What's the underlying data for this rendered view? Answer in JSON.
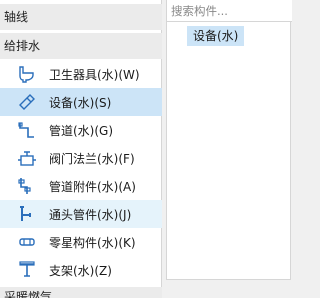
{
  "categories": {
    "axis": "轴线",
    "water": "给排水",
    "hvac": "采暖燃气"
  },
  "items": [
    {
      "label": "卫生器具(水)(W)",
      "icon": "sanitary-fixture-icon",
      "state": "normal"
    },
    {
      "label": "设备(水)(S)",
      "icon": "equipment-icon",
      "state": "selected"
    },
    {
      "label": "管道(水)(G)",
      "icon": "pipe-icon",
      "state": "normal"
    },
    {
      "label": "阀门法兰(水)(F)",
      "icon": "valve-flange-icon",
      "state": "normal"
    },
    {
      "label": "管道附件(水)(A)",
      "icon": "pipe-accessory-icon",
      "state": "normal"
    },
    {
      "label": "通头管件(水)(J)",
      "icon": "pipe-fitting-icon",
      "state": "hover"
    },
    {
      "label": "零星构件(水)(K)",
      "icon": "misc-component-icon",
      "state": "normal"
    },
    {
      "label": "支架(水)(Z)",
      "icon": "bracket-icon",
      "state": "normal"
    }
  ],
  "search": {
    "placeholder": "搜索构件..."
  },
  "component_tag": "设备(水)",
  "colors": {
    "icon_blue": "#2a6ebb",
    "selected_bg": "#cce4f7",
    "category_bg": "#ebebeb"
  }
}
